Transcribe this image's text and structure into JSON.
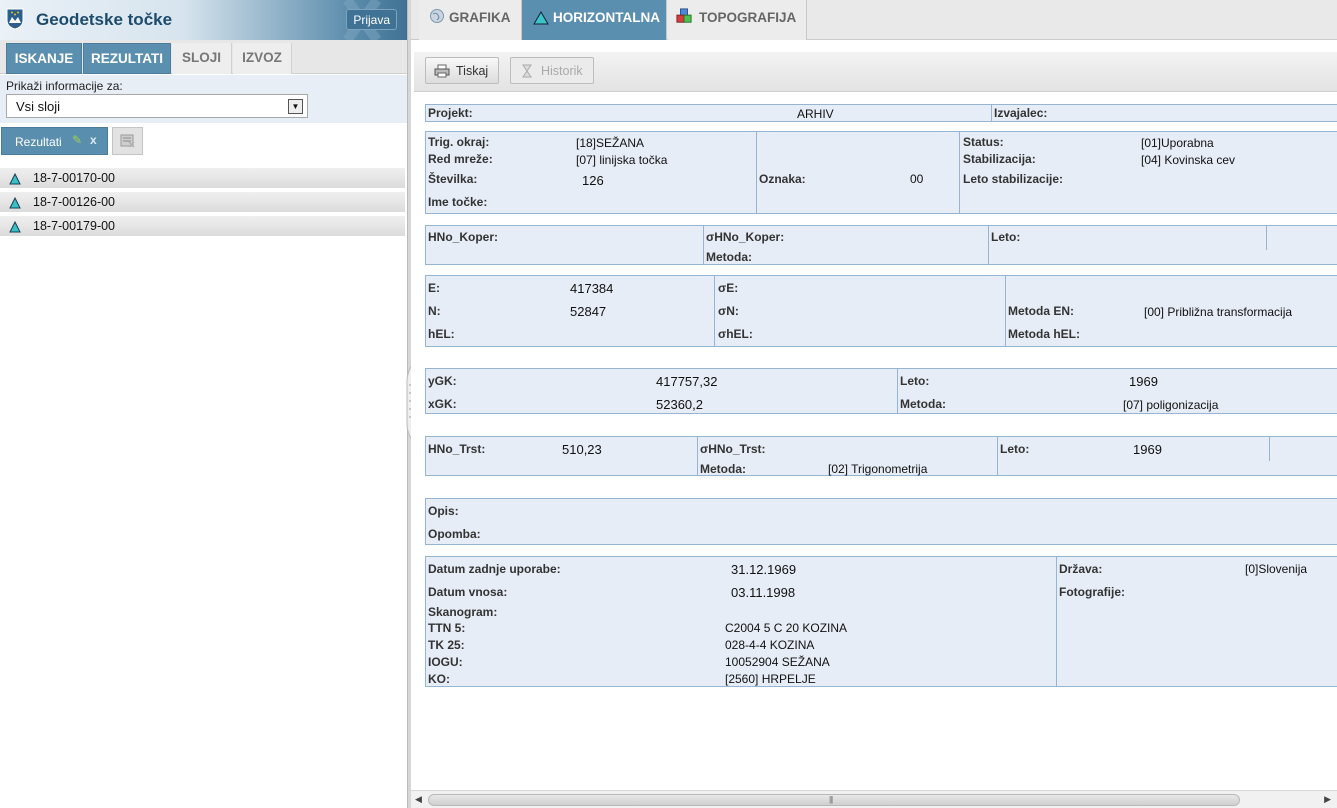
{
  "app": {
    "title": "Geodetske točke",
    "login_label": "Prijava"
  },
  "left_tabs": [
    {
      "label": "ISKANJE",
      "active": true
    },
    {
      "label": "REZULTATI",
      "active": true
    },
    {
      "label": "SLOJI",
      "active": false
    },
    {
      "label": "IZVOZ",
      "active": false
    }
  ],
  "info": {
    "label": "Prikaži informacije za:",
    "selected": "Vsi sloji"
  },
  "results_button": {
    "label": "Rezultati",
    "close": "x"
  },
  "results": [
    {
      "label": "18-7-00170-00"
    },
    {
      "label": "18-7-00126-00"
    },
    {
      "label": "18-7-00179-00"
    }
  ],
  "top_tabs": [
    {
      "label": "GRAFIKA",
      "icon": "globe-icon",
      "active": false
    },
    {
      "label": "HORIZONTALNA",
      "icon": "triangle-icon",
      "active": true
    },
    {
      "label": "TOPOGRAFIJA",
      "icon": "cubes-icon",
      "active": false
    }
  ],
  "toolbar": {
    "print_label": "Tiskaj",
    "history_label": "Historik"
  },
  "projekt": {
    "projekt_label": "Projekt:",
    "projekt_value": "ARHIV",
    "izvajalec_label": "Izvajalec:"
  },
  "basic": {
    "trig_okraj_label": "Trig. okraj:",
    "trig_okraj_value": "[18]SEŽANA",
    "red_mreze_label": "Red mreže:",
    "red_mreze_value": "[07] linijska točka",
    "stevilka_label": "Številka:",
    "stevilka_value": "126",
    "ime_tocke_label": "Ime točke:",
    "oznaka_label": "Oznaka:",
    "oznaka_value": "00",
    "status_label": "Status:",
    "status_value": "[01]Uporabna",
    "stabilizacija_label": "Stabilizacija:",
    "stabilizacija_value": "[04] Kovinska cev",
    "leto_stab_label": "Leto stabilizacije:"
  },
  "hno_koper": {
    "hno_label": "HNo_Koper:",
    "sigma_label": "σHNo_Koper:",
    "metoda_label": "Metoda:",
    "leto_label": "Leto:"
  },
  "en": {
    "e_label": "E:",
    "e_value": "417384",
    "n_label": "N:",
    "n_value": "52847",
    "hel_label": "hEL:",
    "se_label": "σE:",
    "sn_label": "σN:",
    "shel_label": "σhEL:",
    "metoda_en_label": "Metoda EN:",
    "metoda_en_value": "[00] Približna transformacija",
    "metoda_hel_label": "Metoda hEL:"
  },
  "gk": {
    "ygk_label": "yGK:",
    "ygk_value": "417757,32",
    "xgk_label": "xGK:",
    "xgk_value": "52360,2",
    "leto_label": "Leto:",
    "leto_value": "1969",
    "metoda_label": "Metoda:",
    "metoda_value": "[07] poligonizacija"
  },
  "hno_trst": {
    "hno_label": "HNo_Trst:",
    "hno_value": "510,23",
    "sigma_label": "σHNo_Trst:",
    "metoda_label": "Metoda:",
    "metoda_value": "[02] Trigonometrija",
    "leto_label": "Leto:",
    "leto_value": "1969"
  },
  "opis": {
    "opis_label": "Opis:",
    "opomba_label": "Opomba:"
  },
  "meta": {
    "datum_uporabe_label": "Datum zadnje uporabe:",
    "datum_uporabe_value": "31.12.1969",
    "datum_vnosa_label": "Datum vnosa:",
    "datum_vnosa_value": "03.11.1998",
    "skanogram_label": "Skanogram:",
    "ttn5_label": "TTN 5:",
    "ttn5_value": "C2004 5 C 20 KOZINA",
    "tk25_label": "TK 25:",
    "tk25_value": "028-4-4 KOZINA",
    "iogu_label": "IOGU:",
    "iogu_value": "10052904 SEŽANA",
    "ko_label": "KO:",
    "ko_value": "[2560] HRPELJE",
    "drzava_label": "Država:",
    "drzava_value": "[0]Slovenija",
    "fotografije_label": "Fotografije:"
  },
  "colors": {
    "accent": "#5b8fb0",
    "panel_bg": "#e7edf6",
    "panel_border": "#98b4d3",
    "header_text": "#1c4b6c"
  }
}
